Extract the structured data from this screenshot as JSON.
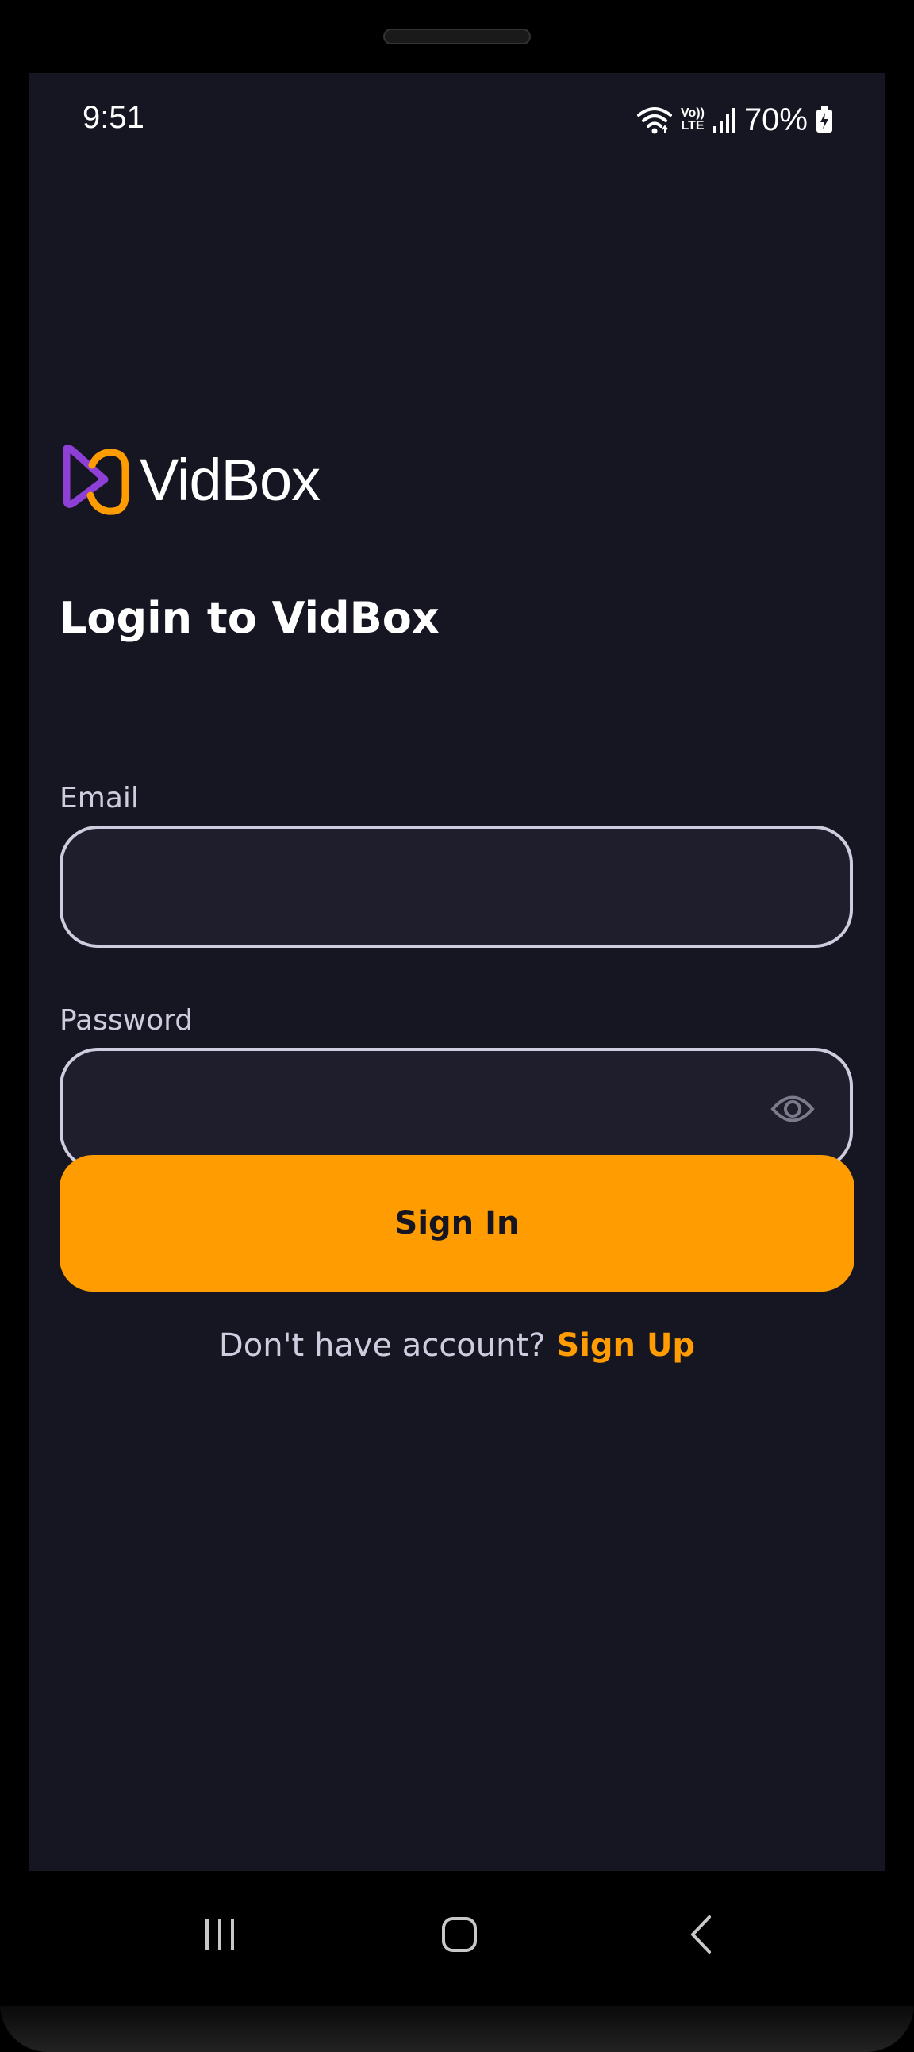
{
  "status_bar": {
    "time": "9:51",
    "battery": "70%",
    "network_top": "Vo))",
    "network_bottom": "LTE"
  },
  "logo": {
    "text": "VidBox",
    "colors": {
      "purple": "#8e3fd6",
      "orange": "#ff9c01"
    }
  },
  "login": {
    "title": "Login to VidBox",
    "email_label": "Email",
    "email_value": "",
    "password_label": "Password",
    "password_value": "",
    "signin_label": "Sign In",
    "signup_prompt": "Don't have account?",
    "signup_link": "Sign Up"
  },
  "icons": {
    "password_toggle": "eye-icon",
    "nav_recents": "recents-icon",
    "nav_home": "home-icon",
    "nav_back": "back-icon"
  },
  "colors": {
    "background": "#161622",
    "input_bg": "#1e1e2d",
    "input_border": "#cdcde0",
    "accent": "#ff9c01"
  }
}
